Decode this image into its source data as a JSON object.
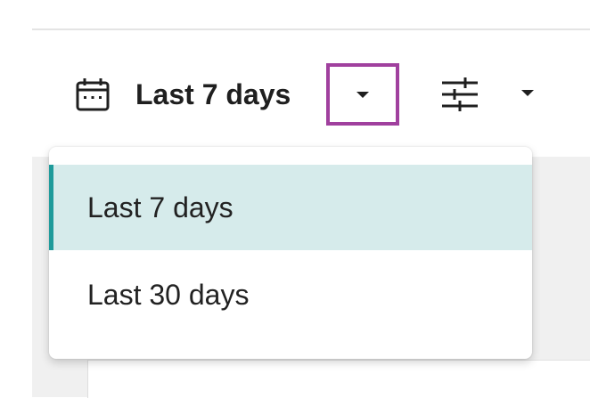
{
  "date_range": {
    "icon": "calendar-icon",
    "selected_label": "Last 7 days",
    "dropdown_icon": "caret-down-icon"
  },
  "filters": {
    "icon": "sliders-icon",
    "dropdown_icon": "caret-down-icon"
  },
  "menu": {
    "items": [
      {
        "label": "Last 7 days",
        "selected": true
      },
      {
        "label": "Last 30 days",
        "selected": false
      }
    ]
  },
  "colors": {
    "highlight_border": "#a0409e",
    "selected_background": "#d6ebeb",
    "selected_accent": "#1e9b9b",
    "text": "#1f1f1f"
  }
}
